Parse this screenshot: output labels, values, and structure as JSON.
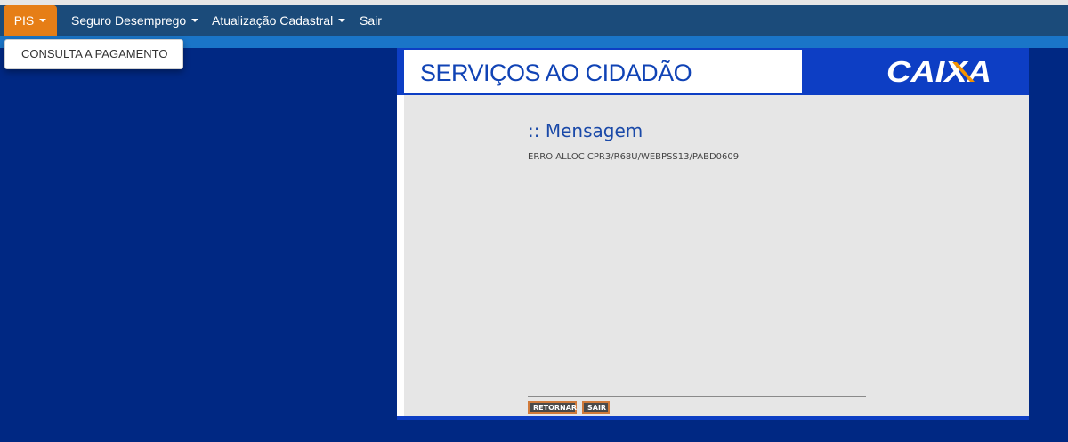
{
  "navbar": {
    "items": [
      {
        "label": "PIS",
        "has_caret": true,
        "active": true
      },
      {
        "label": "Seguro Desemprego",
        "has_caret": true,
        "active": false
      },
      {
        "label": "Atualização Cadastral",
        "has_caret": true,
        "active": false
      },
      {
        "label": "Sair",
        "has_caret": false,
        "active": false
      }
    ]
  },
  "dropdown": {
    "items": [
      {
        "label": "CONSULTA A PAGAMENTO"
      }
    ]
  },
  "banner": {
    "title": "SERVIÇOS AO CIDADÃO",
    "logo_text": "CAIXA"
  },
  "message": {
    "title": ":: Mensagem",
    "text": "ERRO ALLOC CPR3/R68U/WEBPSS13/PABD0609"
  },
  "buttons": {
    "retornar": "RETORNAR",
    "sair": "SAIR"
  },
  "colors": {
    "page_background": "#002883",
    "navbar": "#1b4b7a",
    "navbar_active": "#e67e16",
    "blue_band": "#1a75c8",
    "banner_blue": "#0d3ec4",
    "logo_orange": "#f39200",
    "content_gray": "#e6e6e6",
    "title_blue": "#1a49a8"
  }
}
